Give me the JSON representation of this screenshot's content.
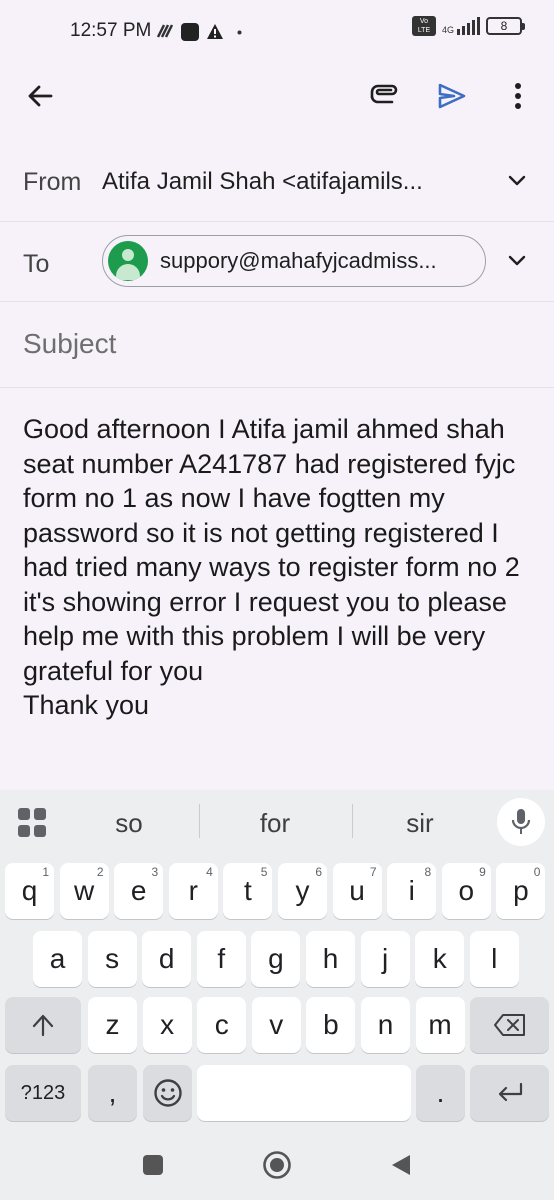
{
  "status_bar": {
    "time": "12:57 PM",
    "network": "4G",
    "battery": "8"
  },
  "toolbar": {
    "back_icon": "arrow-left-icon",
    "attach_icon": "paperclip-icon",
    "send_icon": "send-icon",
    "more_icon": "more-vert-icon",
    "accent": "#3f6dc2"
  },
  "compose": {
    "from_label": "From",
    "from_value": "Atifa Jamil Shah <atifajamils...",
    "to_label": "To",
    "to_chip": "suppory@mahafyjcadmiss...",
    "subject_placeholder": "Subject",
    "body": "Good afternoon I Atifa jamil ahmed shah seat number A241787 had registered fyjc form no 1 as now I have fogtten my password so it is not getting registered I had tried many ways to register form no 2 it's showing error I request you to please help me with this problem I will be very grateful for you\nThank you"
  },
  "keyboard": {
    "suggestions": [
      "so",
      "for",
      "sir"
    ],
    "row1": [
      {
        "k": "q",
        "h": "1"
      },
      {
        "k": "w",
        "h": "2"
      },
      {
        "k": "e",
        "h": "3"
      },
      {
        "k": "r",
        "h": "4"
      },
      {
        "k": "t",
        "h": "5"
      },
      {
        "k": "y",
        "h": "6"
      },
      {
        "k": "u",
        "h": "7"
      },
      {
        "k": "i",
        "h": "8"
      },
      {
        "k": "o",
        "h": "9"
      },
      {
        "k": "p",
        "h": "0"
      }
    ],
    "row2": [
      "a",
      "s",
      "d",
      "f",
      "g",
      "h",
      "j",
      "k",
      "l"
    ],
    "row3": [
      "z",
      "x",
      "c",
      "v",
      "b",
      "n",
      "m"
    ],
    "symbols_label": "?123",
    "comma": ",",
    "period": "."
  },
  "colors": {
    "background": "#f7f2fa",
    "chip_avatar": "#1e9c4e",
    "keyboard_bg": "#eceef0"
  }
}
